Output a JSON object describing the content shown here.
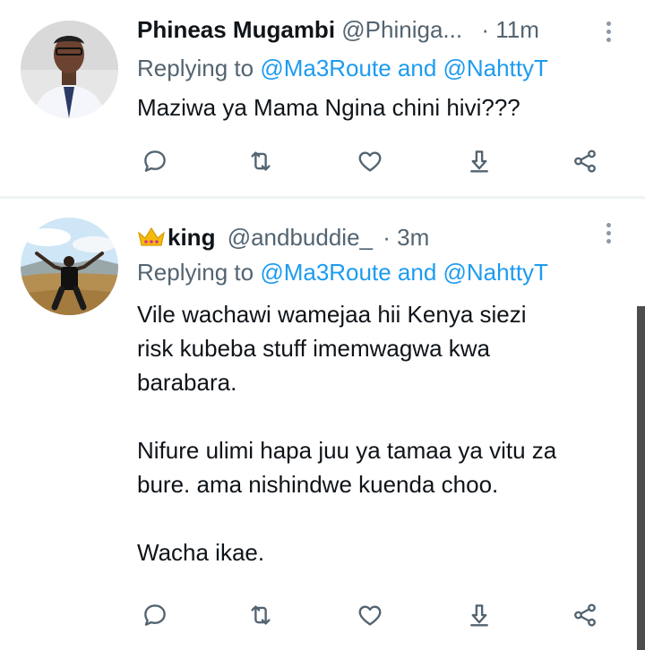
{
  "tweets": [
    {
      "name": "Phineas  Mugambi",
      "handle": "@Phiniga...",
      "time": "· 11m",
      "replying_prefix": "Replying to ",
      "replying_to_1": "@Ma3Route",
      "replying_and": " and ",
      "replying_to_2": "@NahttyT",
      "text": "Maziwa ya Mama Ngina chini hivi???"
    },
    {
      "name": "king",
      "name_emoji": "crown-icon",
      "handle": "@andbuddie_",
      "time": "· 3m",
      "replying_prefix": "Replying to ",
      "replying_to_1": "@Ma3Route",
      "replying_and": " and ",
      "replying_to_2": "@NahttyT",
      "text": "Vile wachawi wamejaa hii Kenya siezi\nrisk kubeba stuff imemwagwa kwa\nbarabara.\n\nNifure ulimi hapa juu ya tamaa ya vitu za\nbure. ama nishindwe kuenda choo.\n\nWacha ikae."
    }
  ],
  "actions": [
    "reply-icon",
    "retweet-icon",
    "like-icon",
    "download-icon",
    "share-icon"
  ],
  "colors": {
    "link": "#1d9bf0",
    "secondary": "#536471",
    "text": "#0f1419",
    "divider": "#eff3f4"
  }
}
